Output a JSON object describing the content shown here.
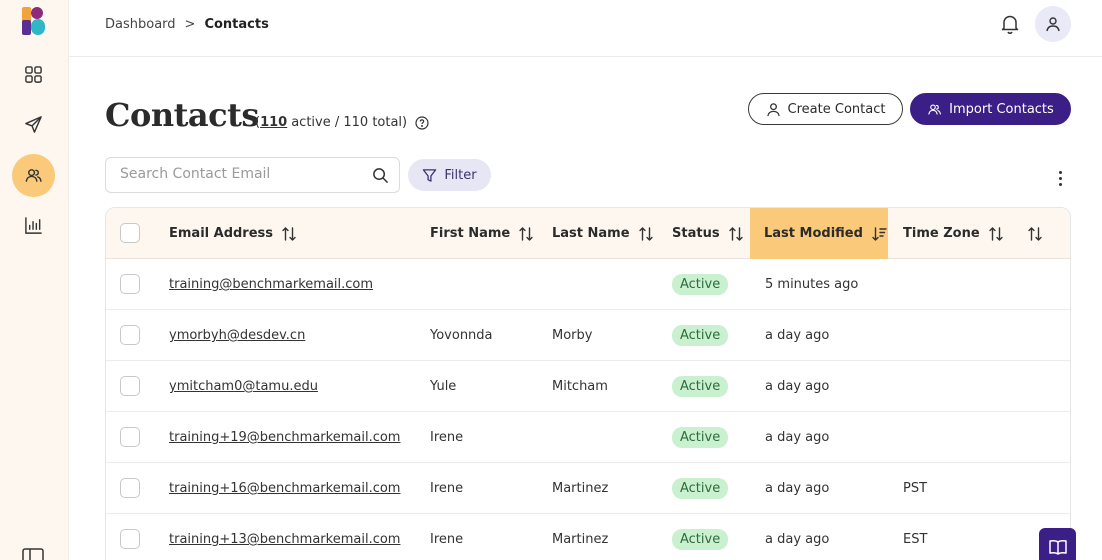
{
  "breadcrumb": {
    "parent": "Dashboard",
    "separator": ">",
    "current": "Contacts"
  },
  "page": {
    "title": "Contacts",
    "count_open": "(",
    "active_count": "110",
    "count_rest": "active / 110 total)"
  },
  "actions": {
    "create_label": "Create Contact",
    "import_label": "Import Contacts",
    "filter_label": "Filter"
  },
  "search": {
    "placeholder": "Search Contact Email",
    "value": ""
  },
  "table": {
    "headers": {
      "email": "Email Address",
      "first_name": "First Name",
      "last_name": "Last Name",
      "status": "Status",
      "last_modified": "Last Modified",
      "time_zone": "Time Zone"
    },
    "sorted_column": "last_modified",
    "rows": [
      {
        "email": "training@benchmarkemail.com",
        "first_name": "",
        "last_name": "",
        "status": "Active",
        "last_modified": "5 minutes ago",
        "time_zone": ""
      },
      {
        "email": "ymorbyh@desdev.cn",
        "first_name": "Yovonnda",
        "last_name": "Morby",
        "status": "Active",
        "last_modified": "a day ago",
        "time_zone": ""
      },
      {
        "email": "ymitcham0@tamu.edu",
        "first_name": "Yule",
        "last_name": "Mitcham",
        "status": "Active",
        "last_modified": "a day ago",
        "time_zone": ""
      },
      {
        "email": "training+19@benchmarkemail.com",
        "first_name": "Irene",
        "last_name": "",
        "status": "Active",
        "last_modified": "a day ago",
        "time_zone": ""
      },
      {
        "email": "training+16@benchmarkemail.com",
        "first_name": "Irene",
        "last_name": "Martinez",
        "status": "Active",
        "last_modified": "a day ago",
        "time_zone": "PST"
      },
      {
        "email": "training+13@benchmarkemail.com",
        "first_name": "Irene",
        "last_name": "Martinez",
        "status": "Active",
        "last_modified": "a day ago",
        "time_zone": "EST"
      }
    ]
  },
  "icons": {
    "nav": [
      "grid-icon",
      "send-icon",
      "contacts-icon",
      "reports-icon"
    ],
    "active_nav": "contacts-icon"
  },
  "colors": {
    "accent": "#3c1f86",
    "nav_active": "#fbc97a",
    "sidebar_bg": "#fdf7f0",
    "badge_bg": "#c9f0cf",
    "badge_text": "#2f6b3b",
    "filter_bg": "#e6e6f5"
  }
}
